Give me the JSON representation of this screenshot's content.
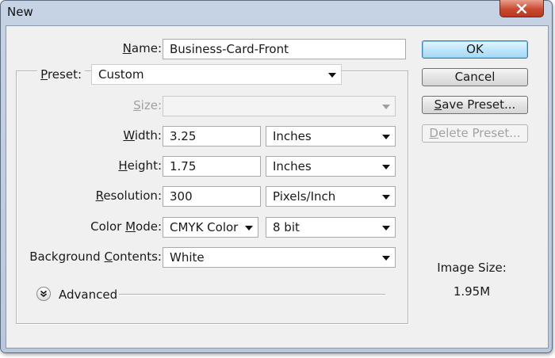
{
  "window": {
    "title": "New"
  },
  "form": {
    "name": {
      "label_u": "N",
      "label_rest": "ame:",
      "value": "Business-Card-Front"
    },
    "preset": {
      "label_u": "P",
      "label_rest": "reset:",
      "value": "Custom"
    },
    "size": {
      "label_u": "S",
      "label_rest": "ize:",
      "value": ""
    },
    "width": {
      "label_u": "W",
      "label_rest": "idth:",
      "value": "3.25",
      "unit": "Inches"
    },
    "height": {
      "label_u": "H",
      "label_rest": "eight:",
      "value": "1.75",
      "unit": "Inches"
    },
    "resolution": {
      "label_u": "R",
      "label_rest": "esolution:",
      "value": "300",
      "unit": "Pixels/Inch"
    },
    "color_mode": {
      "label_pre": "Color ",
      "label_u": "M",
      "label_rest": "ode:",
      "value": "CMYK Color",
      "depth": "8 bit"
    },
    "background": {
      "label_pre": "Background ",
      "label_u": "C",
      "label_rest": "ontents:",
      "value": "White"
    },
    "advanced": {
      "label": "Advanced"
    }
  },
  "buttons": {
    "ok": "OK",
    "cancel": "Cancel",
    "save_u": "S",
    "save_rest": "ave Preset...",
    "delete_u": "D",
    "delete_rest": "elete Preset..."
  },
  "image_size": {
    "label": "Image Size:",
    "value": "1.95M"
  },
  "icons": {
    "close": "close-icon",
    "advanced": "double-chevron-down-icon",
    "dropdown": "chevron-down-icon"
  },
  "colors": {
    "ok_button": "#bee6fd",
    "close_button": "#c94b31",
    "title_bar": "#c6d3e5"
  }
}
